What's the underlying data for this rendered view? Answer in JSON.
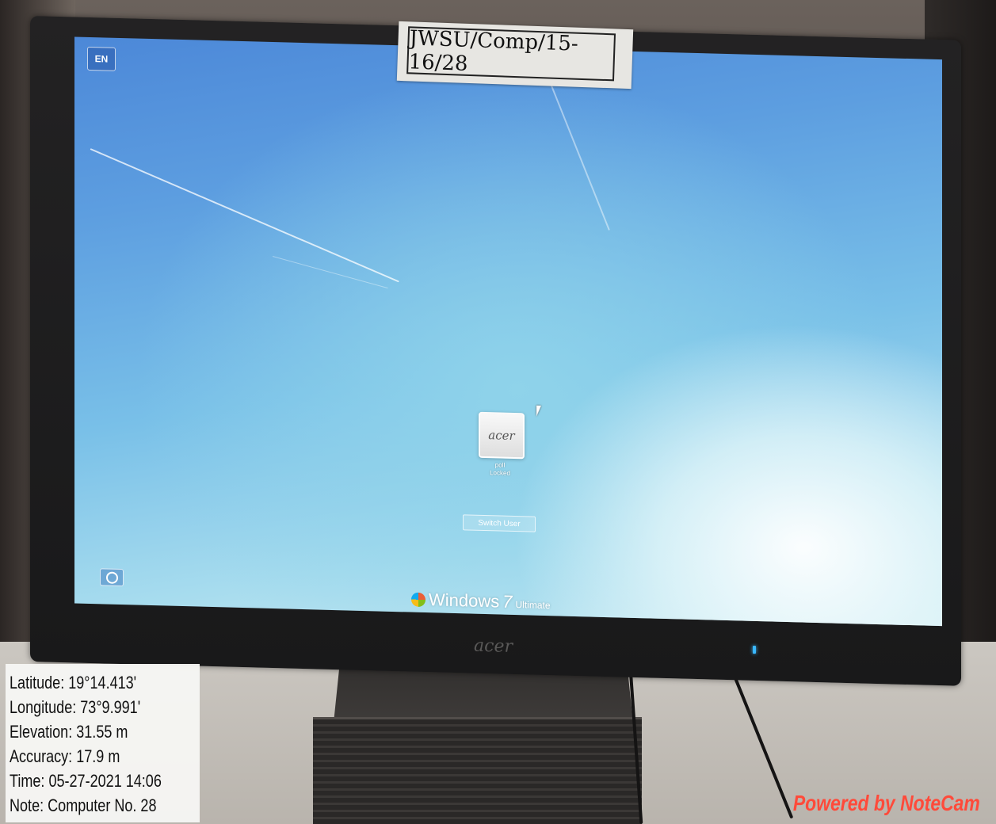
{
  "asset_label": "JWSU/Comp/15-16/28",
  "login_screen": {
    "language_indicator": "EN",
    "user_tile_logo": "acer",
    "user_name": "poll",
    "user_status": "Locked",
    "switch_user_label": "Switch User",
    "ease_of_access_icon": "ease-of-access-icon",
    "os_brand": {
      "word": "Windows",
      "version": "7",
      "edition": "Ultimate"
    }
  },
  "monitor": {
    "bezel_logo": "acer"
  },
  "geo_info": {
    "latitude": "Latitude: 19°14.413'",
    "longitude": "Longitude: 73°9.991'",
    "elevation": "Elevation: 31.55 m",
    "accuracy": "Accuracy: 17.9 m",
    "time": "Time: 05-27-2021 14:06",
    "note": "Note: Computer No. 28"
  },
  "watermark": "Powered by NoteCam",
  "colors": {
    "watermark": "#ff4a3a",
    "screen_top": "#4c88d8",
    "screen_glow": "#ffffff",
    "power_led": "#3ab8ff"
  }
}
